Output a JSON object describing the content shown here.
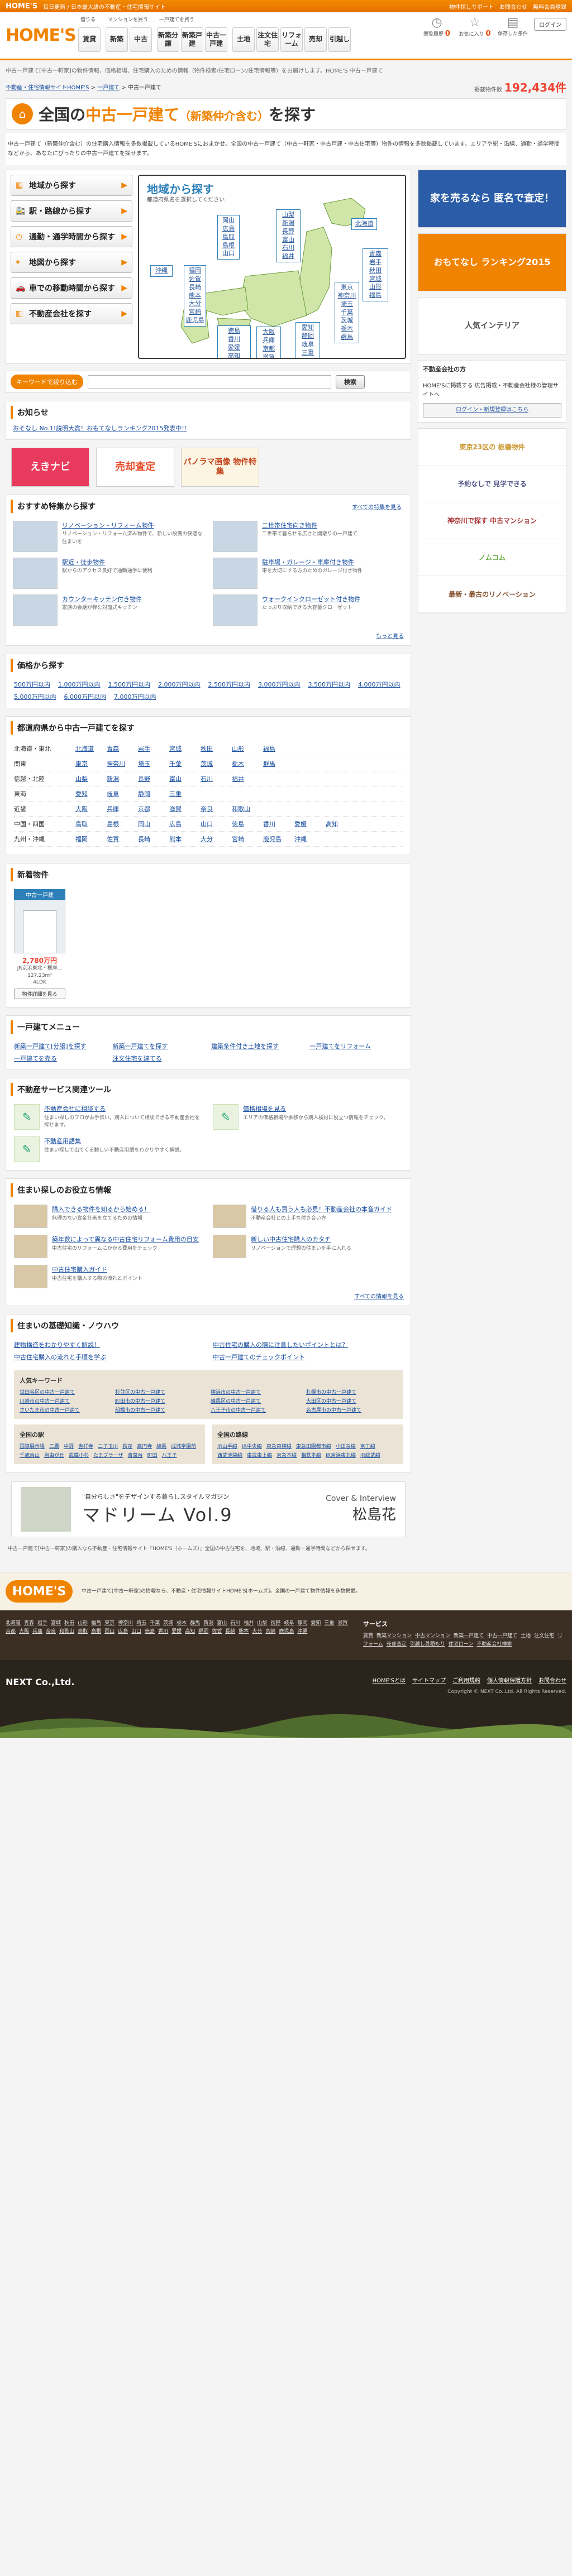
{
  "topbar": {
    "brand": "HOME'S",
    "tagline": "毎日更新 / 日本最大級の不動産・住宅情報サイト",
    "links": [
      "物件探しサポート",
      "お問合わせ",
      "無料会員登録"
    ]
  },
  "header": {
    "logo": "HOME'S",
    "groups": [
      {
        "title": "借りる",
        "buttons": [
          "賃貸"
        ]
      },
      {
        "title": "マンションを買う",
        "buttons": [
          "新築",
          "中古"
        ]
      },
      {
        "title": "一戸建てを買う",
        "buttons": [
          "新築分譲",
          "新築戸建",
          "中古一戸建"
        ]
      },
      {
        "title": "",
        "buttons": [
          "土地",
          "注文住宅",
          "リフォーム",
          "売却",
          "引越し"
        ]
      }
    ],
    "icons": [
      {
        "name": "閲覧履歴",
        "count": "0"
      },
      {
        "name": "お気に入り",
        "count": "0"
      },
      {
        "name": "保存した条件",
        "count": ""
      }
    ],
    "login": "ログイン"
  },
  "breadcrumb_top": "中古一戸建て[中古一軒家]の物件情報、価格相場、住宅購入のための情報（物件検索/住宅ローン/住宅情報等）をお届けします。HOME'S 中古一戸建て",
  "breadcrumb": [
    "不動産・住宅情報サイトHOME'S",
    "一戸建て",
    "中古一戸建て"
  ],
  "count": {
    "label": "掲載物件数",
    "value": "192,434件"
  },
  "page_title": {
    "pre": "全国の",
    "main": "中古一戸建て",
    "paren": "（新築仲介含む）",
    "post": "を探す"
  },
  "intro": "中古一戸建て（新築仲介含む）の住宅購入情報を多数掲載しているHOME'Sにおまかせ。全国の中古一戸建て（中古一軒家・中古戸建・中古住宅等）物件の情報を多数掲載しています。エリアや駅・沿線、通勤・通学時間などから、あなたにぴったりの中古一戸建てを探せます。",
  "search_buttons": [
    {
      "label": "地域から探す",
      "icon": "map-icon"
    },
    {
      "label": "駅・路線から探す",
      "icon": "train-icon"
    },
    {
      "label": "通勤・通学時間から探す",
      "icon": "clock-icon"
    },
    {
      "label": "地図から探す",
      "icon": "pin-icon"
    },
    {
      "label": "車での移動時間から探す",
      "icon": "car-icon"
    },
    {
      "label": "不動産会社を探す",
      "icon": "building-icon"
    }
  ],
  "map": {
    "title": "地域から探す",
    "subtitle": "都道府県名を選択してください",
    "regions": {
      "hokkaido": [
        "北海道"
      ],
      "tohoku": [
        "青森",
        "岩手",
        "秋田",
        "宮城",
        "山形",
        "福島"
      ],
      "kanto": [
        "東京",
        "神奈川",
        "埼玉",
        "千葉",
        "茨城",
        "栃木",
        "群馬"
      ],
      "koshinetsu": [
        "山梨",
        "新潟",
        "長野",
        "富山",
        "石川",
        "福井"
      ],
      "tokai": [
        "愛知",
        "静岡",
        "岐阜",
        "三重"
      ],
      "kinki": [
        "大阪",
        "兵庫",
        "京都",
        "滋賀",
        "奈良",
        "和歌山"
      ],
      "chugoku": [
        "岡山",
        "広島",
        "鳥取",
        "島根",
        "山口"
      ],
      "shikoku": [
        "徳島",
        "香川",
        "愛媛",
        "高知"
      ],
      "kyushu": [
        "福岡",
        "佐賀",
        "長崎",
        "熊本",
        "大分",
        "宮崎",
        "鹿児島"
      ],
      "okinawa": [
        "沖縄"
      ]
    }
  },
  "keyword": {
    "label": "キーワードで絞り込む",
    "placeholder": "",
    "button": "検索"
  },
  "notice": {
    "title": "お知らせ",
    "items": [
      "おそなし No.1!説明大賞！おもてなしランキング2015発表中!!"
    ]
  },
  "promo_banners": [
    "えきナビ",
    "売却査定",
    "パノラマ画像 物件特集"
  ],
  "features": {
    "title": "おすすめ特集から探す",
    "more": "すべての特集を見る",
    "items": [
      {
        "title": "リノベーション・リフォーム物件",
        "desc": "リノベーション・リフォーム済み物件で、新しい設備の快適な住まいを"
      },
      {
        "title": "二世帯住宅向き物件",
        "desc": "二世帯で暮らせる広さと間取りの一戸建て"
      },
      {
        "title": "駅近・徒歩物件",
        "desc": "駅からのアクセス良好で通勤通学に便利"
      },
      {
        "title": "駐車場・ガレージ・車庫付き物件",
        "desc": "車を大切にする方のためのガレージ付き物件"
      },
      {
        "title": "カウンターキッチン付き物件",
        "desc": "家族の会話が弾む対面式キッチン"
      },
      {
        "title": "ウォークインクローゼット付き物件",
        "desc": "たっぷり収納できる大容量クローゼット"
      }
    ],
    "more2": "もっと見る"
  },
  "price": {
    "title": "価格から探す",
    "items": [
      "500万円以内",
      "1,000万円以内",
      "1,500万円以内",
      "2,000万円以内",
      "2,500万円以内",
      "3,000万円以内",
      "3,500万円以内",
      "4,000万円以内",
      "5,000万円以内",
      "6,000万円以内",
      "7,000万円以内"
    ]
  },
  "prefs": {
    "title": "都道府県から中古一戸建てを探す",
    "rows": [
      {
        "region": "北海道・東北",
        "items": [
          "北海道",
          "青森",
          "岩手",
          "宮城",
          "秋田",
          "山形",
          "福島"
        ]
      },
      {
        "region": "関東",
        "items": [
          "東京",
          "神奈川",
          "埼玉",
          "千葉",
          "茨城",
          "栃木",
          "群馬"
        ]
      },
      {
        "region": "信越・北陸",
        "items": [
          "山梨",
          "新潟",
          "長野",
          "富山",
          "石川",
          "福井"
        ]
      },
      {
        "region": "東海",
        "items": [
          "愛知",
          "岐阜",
          "静岡",
          "三重"
        ]
      },
      {
        "region": "近畿",
        "items": [
          "大阪",
          "兵庫",
          "京都",
          "滋賀",
          "奈良",
          "和歌山"
        ]
      },
      {
        "region": "中国・四国",
        "items": [
          "鳥取",
          "島根",
          "岡山",
          "広島",
          "山口",
          "徳島",
          "香川",
          "愛媛",
          "高知"
        ]
      },
      {
        "region": "九州・沖縄",
        "items": [
          "福岡",
          "佐賀",
          "長崎",
          "熊本",
          "大分",
          "宮崎",
          "鹿児島",
          "沖縄"
        ]
      }
    ]
  },
  "newprops": {
    "title": "新着物件",
    "items": [
      {
        "tag": "中古一戸建",
        "price": "2,780万円",
        "place": "JR京浜東北・根岸...",
        "size": "127.23m²",
        "layout": "4LDK",
        "button": "物件詳細を見る"
      }
    ]
  },
  "menu": {
    "title": "一戸建てメニュー",
    "items": [
      "新築一戸建て[分譲]を探す",
      "新築一戸建てを探す",
      "建築条件付き土地を探す",
      "一戸建てをリフォーム",
      "一戸建てを売る",
      "注文住宅を建てる"
    ]
  },
  "tools": {
    "title": "不動産サービス関連ツール",
    "items": [
      {
        "title": "不動産会社に相談する",
        "desc": "住まい探しのプロがお手伝い。購入について相談できる不動産会社を探せます。"
      },
      {
        "title": "価格相場を見る",
        "desc": "エリアの価格相場や推移から購入検討に役立つ情報をチェック。"
      },
      {
        "title": "不動産用語集",
        "desc": "住まい探しで出てくる難しい不動産用語をわかりやすく解説。"
      }
    ]
  },
  "info": {
    "title": "住まい探しのお役立ち情報",
    "items": [
      {
        "title": "購入できる物件を知るから始める！",
        "desc": "無理のない資金計画を立てるための情報"
      },
      {
        "title": "借りる人も買う人も必見！不動産会社の本音ガイド",
        "desc": "不動産会社との上手な付き合い方"
      },
      {
        "title": "築年数によって異なる中古住宅リフォーム費用の目安",
        "desc": "中古住宅のリフォームにかかる費用をチェック"
      },
      {
        "title": "新しい中古住宅購入のカタチ",
        "desc": "リノベーションで理想の住まいを手に入れる"
      },
      {
        "title": "中古住宅購入ガイド",
        "desc": "中古住宅を購入する際の流れとポイント"
      }
    ],
    "more": "すべての情報を見る"
  },
  "knowhow": {
    "title": "住まいの基礎知識・ノウハウ",
    "items": [
      "建物構造をわかりやすく解説！",
      "中古住宅の購入の際に注意したいポイントとは？",
      "中古住宅購入の流れと手順を学ぶ",
      "中古一戸建てのチェックポイント"
    ]
  },
  "keywords": {
    "title": "人気キーワード",
    "items": [
      "世田谷区の中古一戸建て",
      "杉並区の中古一戸建て",
      "横浜市の中古一戸建て",
      "札幌市の中古一戸建て",
      "川崎市の中古一戸建て",
      "町田市の中古一戸建て",
      "練馬区の中古一戸建て",
      "大田区の中古一戸建て",
      "さいたま市の中古一戸建て",
      "船橋市の中古一戸建て",
      "八王子市の中古一戸建て",
      "名古屋市の中古一戸建て"
    ]
  },
  "stations": {
    "title": "全国の駅",
    "items": [
      "国際展示場",
      "三鷹",
      "中野",
      "吉祥寺",
      "二子玉川",
      "荻窪",
      "高円寺",
      "練馬",
      "成城学園前",
      "千歳烏山",
      "自由が丘",
      "武蔵小杉",
      "たまプラーザ",
      "青葉台",
      "町田",
      "八王子"
    ]
  },
  "lines": {
    "title": "全国の路線",
    "items": [
      "JR山手線",
      "JR中央線",
      "東急東横線",
      "東急田園都市線",
      "小田急線",
      "京王線",
      "西武池袋線",
      "東武東上線",
      "京急本線",
      "相鉄本線",
      "JR京浜東北線",
      "JR総武線"
    ]
  },
  "magazine": {
    "tag": "\"自分らしさ\"をデザインする暮らしスタイルマガジン",
    "name": "マドリーム Vol.9",
    "cover1": "Cover & Interview",
    "cover2": "松島花"
  },
  "bottom_note": "中古一戸建て[中古一軒家]の購入なら不動産・住宅情報サイト『HOME'S（ホームズ）』全国の中古住宅を、地域、駅・沿線、通勤・通学時間などから探せます。",
  "sidebar": {
    "ads": [
      "家を売るなら 匿名で査定！",
      "おもてなし ランキング2015",
      "人気インテリア"
    ],
    "login_head": "不動産会社の方",
    "login_text": "HOME'Sに掲載する 広告掲載・不動産会社様の管理サイトへ",
    "login_btn": "ログイン・新規登録はこちら",
    "ads2": [
      "東京23区の 板橋物件",
      "予約なしで 見学できる",
      "神奈川で探す 中古マンション",
      "ノムコム",
      "最新・最古のリノベーション"
    ]
  },
  "footer": {
    "about": "中古一戸建て[中古一軒家]の情報なら、不動産・住宅情報サイトHOME'S[ホームズ]。全国の一戸建て物件情報を多数掲載。",
    "areas": [
      "北海道",
      "青森",
      "岩手",
      "宮城",
      "秋田",
      "山形",
      "福島",
      "東京",
      "神奈川",
      "埼玉",
      "千葉",
      "茨城",
      "栃木",
      "群馬",
      "新潟",
      "富山",
      "石川",
      "福井",
      "山梨",
      "長野",
      "岐阜",
      "静岡",
      "愛知",
      "三重",
      "滋賀",
      "京都",
      "大阪",
      "兵庫",
      "奈良",
      "和歌山",
      "鳥取",
      "島根",
      "岡山",
      "広島",
      "山口",
      "徳島",
      "香川",
      "愛媛",
      "高知",
      "福岡",
      "佐賀",
      "長崎",
      "熊本",
      "大分",
      "宮崎",
      "鹿児島",
      "沖縄"
    ],
    "service_title": "サービス",
    "services": [
      "賃貸",
      "新築マンション",
      "中古マンション",
      "新築一戸建て",
      "中古一戸建て",
      "土地",
      "注文住宅",
      "リフォーム",
      "売却査定",
      "引越し見積もり",
      "住宅ローン",
      "不動産会社検索"
    ],
    "company": "NEXT Co.,Ltd.",
    "links": [
      "HOME'Sとは",
      "サイトマップ",
      "ご利用規約",
      "個人情報保護方針",
      "お問合わせ"
    ],
    "copyright": "Copyright © NEXT Co.,Ltd. All Rights Reserved."
  }
}
